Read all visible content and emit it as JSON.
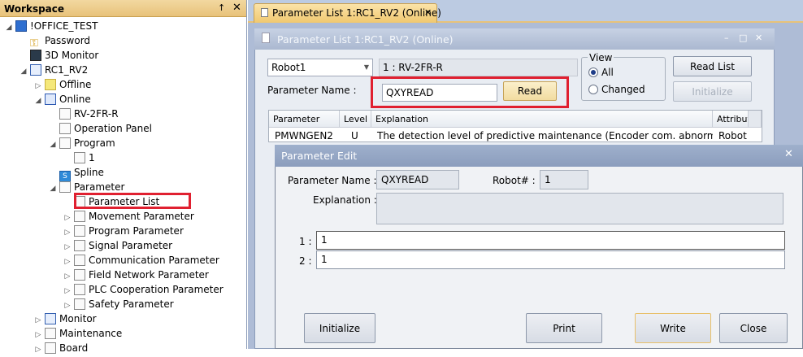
{
  "workspace": {
    "title": "Workspace",
    "pin": "↑",
    "close": "✕",
    "items": [
      {
        "label": "!OFFICE_TEST",
        "exp": "◢",
        "icon": "project-icon"
      },
      {
        "label": "Password",
        "exp": "",
        "icon": "key-icon"
      },
      {
        "label": "3D Monitor",
        "exp": "",
        "icon": "3d-monitor-icon"
      },
      {
        "label": "RC1_RV2",
        "exp": "◢",
        "icon": "robot-controller-icon"
      },
      {
        "label": "Offline",
        "exp": "▷",
        "icon": "offline-icon"
      },
      {
        "label": "Online",
        "exp": "◢",
        "icon": "online-icon"
      },
      {
        "label": "RV-2FR-R",
        "exp": "",
        "icon": "robot-icon"
      },
      {
        "label": "Operation Panel",
        "exp": "",
        "icon": "operation-panel-icon"
      },
      {
        "label": "Program",
        "exp": "◢",
        "icon": "program-icon"
      },
      {
        "label": "1",
        "exp": "",
        "icon": "program-file-icon"
      },
      {
        "label": "Spline",
        "exp": "",
        "icon": "spline-icon"
      },
      {
        "label": "Parameter",
        "exp": "◢",
        "icon": "parameter-icon"
      },
      {
        "label": "Parameter List",
        "exp": "",
        "icon": "parameter-list-icon"
      },
      {
        "label": "Movement Parameter",
        "exp": "▷",
        "icon": "parameter-group-icon"
      },
      {
        "label": "Program Parameter",
        "exp": "▷",
        "icon": "parameter-group-icon"
      },
      {
        "label": "Signal Parameter",
        "exp": "▷",
        "icon": "parameter-group-icon"
      },
      {
        "label": "Communication Parameter",
        "exp": "▷",
        "icon": "parameter-group-icon"
      },
      {
        "label": "Field Network Parameter",
        "exp": "▷",
        "icon": "parameter-group-icon"
      },
      {
        "label": "PLC Cooperation Parameter",
        "exp": "▷",
        "icon": "parameter-group-icon"
      },
      {
        "label": "Safety Parameter",
        "exp": "▷",
        "icon": "parameter-group-icon"
      },
      {
        "label": "Monitor",
        "exp": "▷",
        "icon": "monitor-icon"
      },
      {
        "label": "Maintenance",
        "exp": "▷",
        "icon": "maintenance-icon"
      },
      {
        "label": "Board",
        "exp": "▷",
        "icon": "board-icon"
      }
    ]
  },
  "doc_tab": {
    "label": "Parameter List 1:RC1_RV2  (Online)",
    "close": "✕"
  },
  "param_list": {
    "title": "Parameter List 1:RC1_RV2  (Online)",
    "minimize": "–",
    "maximize": "□",
    "close": "✕",
    "robot_select": "Robot1",
    "robot_name": "1 : RV-2FR-R",
    "view_label": "View",
    "view_all": "All",
    "view_changed": "Changed",
    "read_list": "Read List",
    "initialize": "Initialize",
    "param_name_label": "Parameter Name :",
    "param_name_value": "QXYREAD",
    "read_btn": "Read",
    "columns": [
      "Parameter",
      "Level",
      "Explanation",
      "Attribut"
    ],
    "row": [
      "PMWNGEN2",
      "U",
      "The detection level of predictive maintenance (Encoder com. abnormali...",
      "Robot"
    ]
  },
  "param_edit": {
    "title": "Parameter Edit",
    "close": "✕",
    "name_label": "Parameter Name :",
    "name_value": "QXYREAD",
    "robot_label": "Robot# :",
    "robot_value": "1",
    "explanation_label": "Explanation :",
    "explanation_value": "",
    "rows": [
      {
        "label": "1 :",
        "value": "1"
      },
      {
        "label": "2 :",
        "value": "1"
      }
    ],
    "btn_initialize": "Initialize",
    "btn_print": "Print",
    "btn_write": "Write",
    "btn_close": "Close"
  }
}
